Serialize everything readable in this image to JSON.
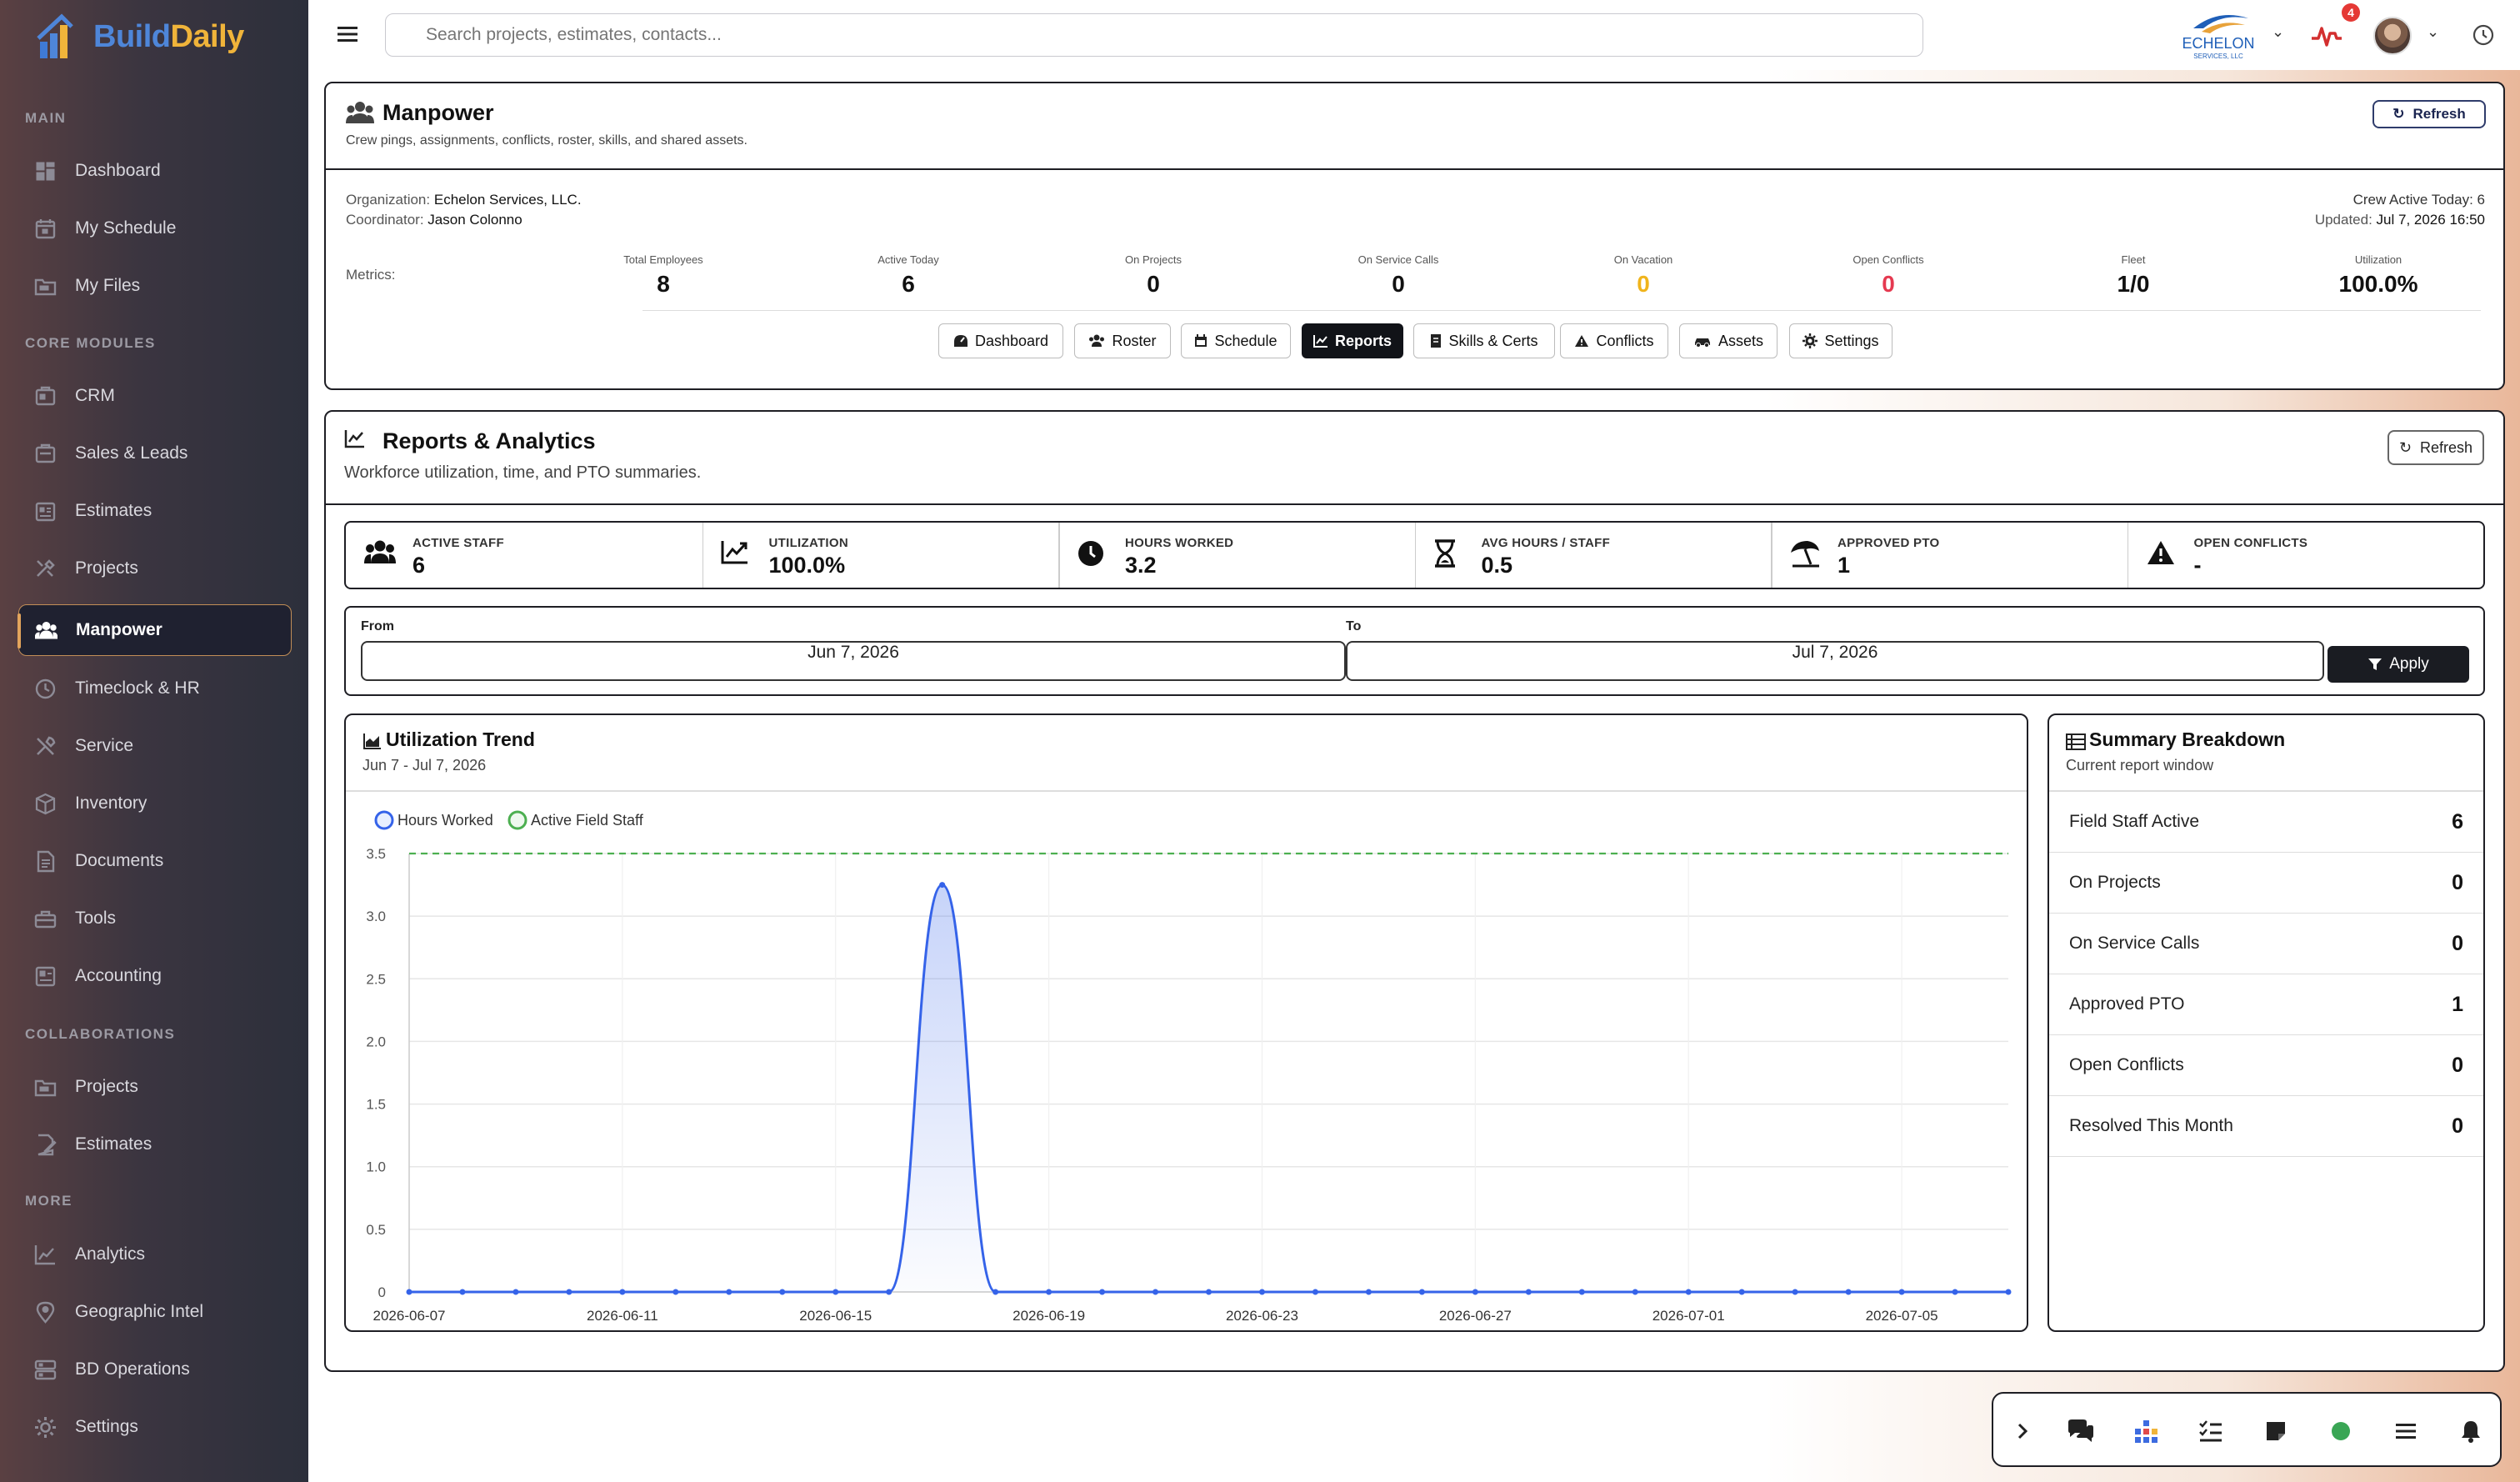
{
  "brand": {
    "name_part1": "Build",
    "name_part2": "Daily"
  },
  "sidebar": {
    "sections": {
      "main": "MAIN",
      "core": "CORE MODULES",
      "collab": "COLLABORATIONS",
      "more": "MORE"
    },
    "items": [
      {
        "label": "Dashboard",
        "icon": "dashboard-icon"
      },
      {
        "label": "My Schedule",
        "icon": "calendar-icon"
      },
      {
        "label": "My Files",
        "icon": "folder-icon"
      },
      {
        "label": "CRM",
        "icon": "crm-icon"
      },
      {
        "label": "Sales & Leads",
        "icon": "leads-icon"
      },
      {
        "label": "Estimates",
        "icon": "estimate-icon"
      },
      {
        "label": "Projects",
        "icon": "tools-icon"
      },
      {
        "label": "Manpower",
        "icon": "users-icon"
      },
      {
        "label": "Timeclock & HR",
        "icon": "clock-icon"
      },
      {
        "label": "Service",
        "icon": "wrench-icon"
      },
      {
        "label": "Inventory",
        "icon": "box-icon"
      },
      {
        "label": "Documents",
        "icon": "document-icon"
      },
      {
        "label": "Tools",
        "icon": "toolbox-icon"
      },
      {
        "label": "Accounting",
        "icon": "calculator-icon"
      },
      {
        "label": "Projects",
        "icon": "folder-icon"
      },
      {
        "label": "Estimates",
        "icon": "edit-doc-icon"
      },
      {
        "label": "Analytics",
        "icon": "chart-icon"
      },
      {
        "label": "Geographic Intel",
        "icon": "map-pin-icon"
      },
      {
        "label": "BD Operations",
        "icon": "server-icon"
      },
      {
        "label": "Settings",
        "icon": "gear-icon"
      }
    ]
  },
  "topbar": {
    "search_placeholder": "Search projects, estimates, contacts...",
    "org_logo_text": "ECHELON",
    "org_logo_sub": "SERVICES, LLC",
    "notifications_count": "4"
  },
  "manpower": {
    "title": "Manpower",
    "subtitle": "Crew pings, assignments, conflicts, roster, skills, and shared assets.",
    "refresh_label": "Refresh",
    "org_label": "Organization:",
    "org_value": "Echelon Services, LLC.",
    "coord_label": "Coordinator:",
    "coord_value": "Jason Colonno",
    "crew_active": "Crew Active Today: 6",
    "updated_label": "Updated:",
    "updated_value": "Jul 7, 2026 16:50",
    "metrics_label": "Metrics:",
    "metrics": [
      {
        "label": "Total Employees",
        "value": "8"
      },
      {
        "label": "Active Today",
        "value": "6"
      },
      {
        "label": "On Projects",
        "value": "0"
      },
      {
        "label": "On Service Calls",
        "value": "0"
      },
      {
        "label": "On Vacation",
        "value": "0"
      },
      {
        "label": "Open Conflicts",
        "value": "0"
      },
      {
        "label": "Fleet",
        "value": "1/0"
      },
      {
        "label": "Utilization",
        "value": "100.0%"
      }
    ],
    "tabs": [
      "Dashboard",
      "Roster",
      "Schedule",
      "Reports",
      "Skills & Certs",
      "Conflicts",
      "Assets",
      "Settings"
    ]
  },
  "reports": {
    "title": "Reports & Analytics",
    "subtitle": "Workforce utilization, time, and PTO summaries.",
    "refresh_label": "Refresh",
    "stats": [
      {
        "label": "ACTIVE STAFF",
        "value": "6"
      },
      {
        "label": "UTILIZATION",
        "value": "100.0%"
      },
      {
        "label": "HOURS WORKED",
        "value": "3.2"
      },
      {
        "label": "AVG HOURS / STAFF",
        "value": "0.5"
      },
      {
        "label": "APPROVED PTO",
        "value": "1"
      },
      {
        "label": "OPEN CONFLICTS",
        "value": "-"
      }
    ],
    "from_label": "From",
    "from_value": "Jun 7, 2026",
    "to_label": "To",
    "to_value": "Jul 7, 2026",
    "apply_label": "Apply",
    "chart_title": "Utilization Trend",
    "chart_subtitle": "Jun 7 - Jul 7, 2026",
    "summary_title": "Summary Breakdown",
    "summary_subtitle": "Current report window",
    "summary": [
      {
        "label": "Field Staff Active",
        "value": "6"
      },
      {
        "label": "On Projects",
        "value": "0"
      },
      {
        "label": "On Service Calls",
        "value": "0"
      },
      {
        "label": "Approved PTO",
        "value": "1"
      },
      {
        "label": "Open Conflicts",
        "value": "0"
      },
      {
        "label": "Resolved This Month",
        "value": "0"
      }
    ]
  },
  "chart_data": {
    "type": "line",
    "title": "Utilization Trend",
    "subtitle": "Jun 7 - Jul 7, 2026",
    "xlabel": "",
    "ylabel": "",
    "ylim": [
      0,
      3.5
    ],
    "yticks": [
      "0",
      "0.5",
      "1.0",
      "1.5",
      "2.0",
      "2.5",
      "3.0",
      "3.5"
    ],
    "x_tick_labels": [
      "2026-06-07",
      "2026-06-11",
      "2026-06-15",
      "2026-06-19",
      "2026-06-23",
      "2026-06-27",
      "2026-07-01",
      "2026-07-05"
    ],
    "x": [
      "2026-06-07",
      "2026-06-08",
      "2026-06-09",
      "2026-06-10",
      "2026-06-11",
      "2026-06-12",
      "2026-06-13",
      "2026-06-14",
      "2026-06-15",
      "2026-06-16",
      "2026-06-17",
      "2026-06-18",
      "2026-06-19",
      "2026-06-20",
      "2026-06-21",
      "2026-06-22",
      "2026-06-23",
      "2026-06-24",
      "2026-06-25",
      "2026-06-26",
      "2026-06-27",
      "2026-06-28",
      "2026-06-29",
      "2026-06-30",
      "2026-07-01",
      "2026-07-02",
      "2026-07-03",
      "2026-07-04",
      "2026-07-05",
      "2026-07-06",
      "2026-07-07"
    ],
    "series": [
      {
        "name": "Hours Worked",
        "color": "#3563e9",
        "values": [
          0,
          0,
          0,
          0,
          0,
          0,
          0,
          0,
          0,
          0,
          3.25,
          0,
          0,
          0,
          0,
          0,
          0,
          0,
          0,
          0,
          0,
          0,
          0,
          0,
          0,
          0,
          0,
          0,
          0,
          0,
          0
        ]
      },
      {
        "name": "Active Field Staff",
        "color": "#4caf50",
        "style": "dashed",
        "values": [
          6,
          6,
          6,
          6,
          6,
          6,
          6,
          6,
          6,
          6,
          6,
          6,
          6,
          6,
          6,
          6,
          6,
          6,
          6,
          6,
          6,
          6,
          6,
          6,
          6,
          6,
          6,
          6,
          6,
          6,
          6
        ]
      }
    ],
    "legend": "top-left",
    "grid": true
  }
}
